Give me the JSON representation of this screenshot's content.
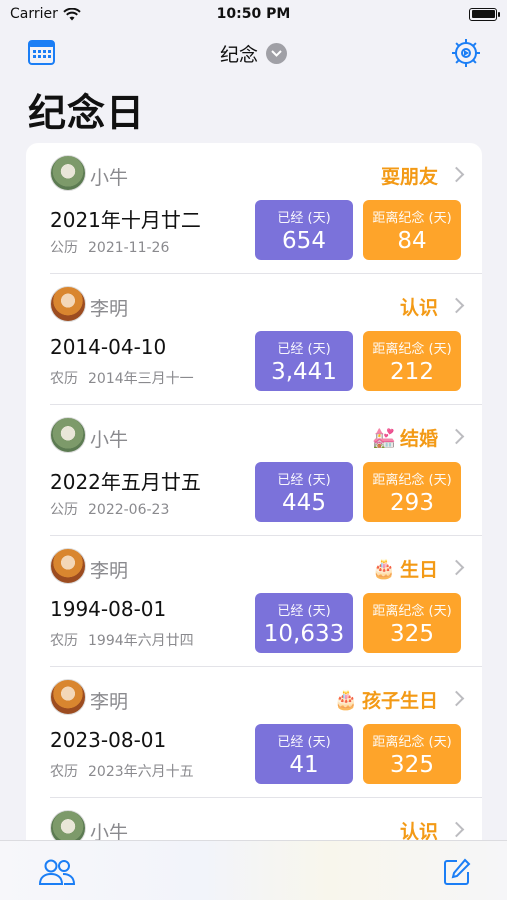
{
  "status_bar": {
    "carrier": "Carrier",
    "time": "10:50 PM"
  },
  "nav": {
    "title": "纪念",
    "calendar_icon": "calendar-icon",
    "settings_icon": "gear-icon"
  },
  "page_title": "纪念日",
  "labels": {
    "passed": "已经 (天)",
    "remaining": "距离纪念 (天)"
  },
  "items": [
    {
      "person": "小牛",
      "kind": "耍朋友",
      "emoji": "",
      "date": "2021年十月廿二",
      "calendar": "公历",
      "alt_date": "2021-11-26",
      "passed": "654",
      "remaining": "84"
    },
    {
      "person": "李明",
      "kind": "认识",
      "emoji": "",
      "date": "2014-04-10",
      "calendar": "农历",
      "alt_date": "2014年三月十一",
      "passed": "3,441",
      "remaining": "212"
    },
    {
      "person": "小牛",
      "kind": "结婚",
      "emoji": "💒",
      "date": "2022年五月廿五",
      "calendar": "公历",
      "alt_date": "2022-06-23",
      "passed": "445",
      "remaining": "293"
    },
    {
      "person": "李明",
      "kind": "生日",
      "emoji": "🎂",
      "date": "1994-08-01",
      "calendar": "农历",
      "alt_date": "1994年六月廿四",
      "passed": "10,633",
      "remaining": "325"
    },
    {
      "person": "李明",
      "kind": "孩子生日",
      "emoji": "🎂",
      "date": "2023-08-01",
      "calendar": "农历",
      "alt_date": "2023年六月十五",
      "passed": "41",
      "remaining": "325"
    },
    {
      "person": "小牛",
      "kind": "认识",
      "emoji": "",
      "date": "",
      "calendar": "",
      "alt_date": "",
      "passed": "",
      "remaining": ""
    }
  ],
  "tab_bar": {
    "people_icon": "people-icon",
    "edit_icon": "edit-icon"
  }
}
